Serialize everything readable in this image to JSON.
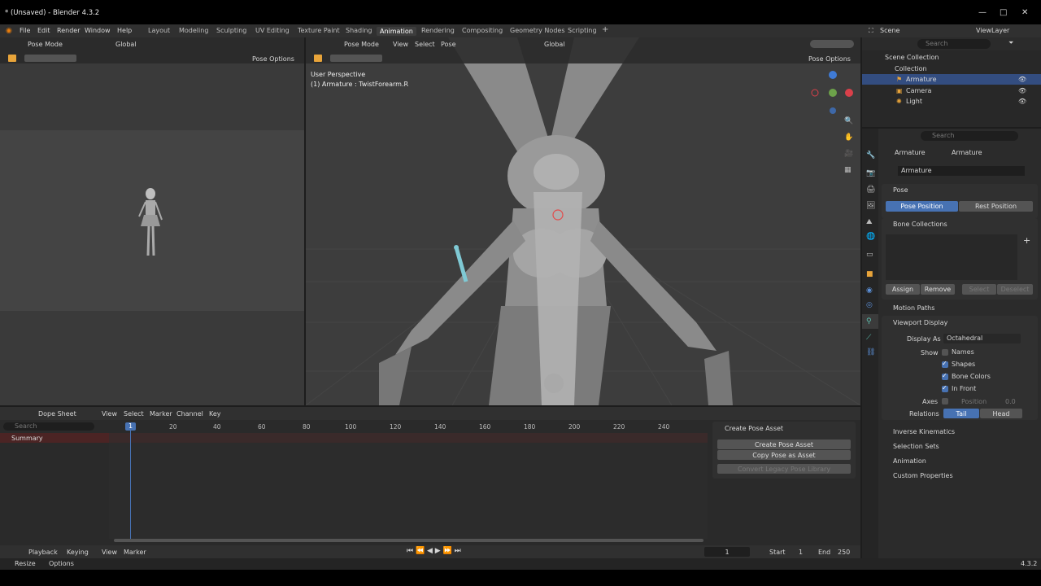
{
  "titlebar": {
    "title": "* (Unsaved) - Blender 4.3.2"
  },
  "menu": [
    "File",
    "Edit",
    "Render",
    "Window",
    "Help"
  ],
  "workspaces": [
    "Layout",
    "Modeling",
    "Sculpting",
    "UV Editing",
    "Texture Paint",
    "Shading",
    "Animation",
    "Rendering",
    "Compositing",
    "Geometry Nodes",
    "Scripting"
  ],
  "active_workspace": "Animation",
  "scene": {
    "label": "Scene",
    "viewlayer": "ViewLayer"
  },
  "left_view": {
    "mode": "Pose Mode",
    "orient": "Global",
    "pose_options": "Pose Options"
  },
  "main_view": {
    "mode": "Pose Mode",
    "menus": [
      "View",
      "Select",
      "Pose"
    ],
    "orient": "Global",
    "pose_options": "Pose Options",
    "overlay_line1": "User Perspective",
    "overlay_line2": "(1) Armature : TwistForearm.R"
  },
  "outliner": {
    "search_placeholder": "Search",
    "items": [
      "Scene Collection",
      "Collection",
      "Armature",
      "Camera",
      "Light"
    ]
  },
  "properties": {
    "search_placeholder": "Search",
    "breadcrumb": [
      "Armature",
      "Armature"
    ],
    "data_name": "Armature",
    "pose_header": "Pose",
    "pose_position": "Pose Position",
    "rest_position": "Rest Position",
    "bone_collections": "Bone Collections",
    "assign": "Assign",
    "remove": "Remove",
    "select": "Select",
    "deselect": "Deselect",
    "motion_paths": "Motion Paths",
    "viewport_display": "Viewport Display",
    "display_as_label": "Display As",
    "display_as_value": "Octahedral",
    "show_label": "Show",
    "names": "Names",
    "shapes": "Shapes",
    "bone_colors": "Bone Colors",
    "in_front": "In Front",
    "axes": "Axes",
    "position": "Position",
    "position_value": "0.0",
    "relations": "Relations",
    "tail": "Tail",
    "head": "Head",
    "inverse_kinematics": "Inverse Kinematics",
    "selection_sets": "Selection Sets",
    "animation": "Animation",
    "custom_properties": "Custom Properties"
  },
  "dopesheet": {
    "mode": "Dope Sheet",
    "menus": [
      "View",
      "Select",
      "Marker",
      "Channel",
      "Key"
    ],
    "search_placeholder": "Search",
    "summary": "Summary",
    "current_frame": "1",
    "ticks": [
      "20",
      "40",
      "60",
      "80",
      "100",
      "120",
      "140",
      "160",
      "180",
      "200",
      "220",
      "240"
    ],
    "asset_panel_title": "Create Pose Asset",
    "create_pose_asset": "Create Pose Asset",
    "copy_pose_as_asset": "Copy Pose as Asset",
    "convert_legacy": "Convert Legacy Pose Library"
  },
  "timeline": {
    "playback": "Playback",
    "keying": "Keying",
    "view": "View",
    "marker": "Marker",
    "frame": "1",
    "start_label": "Start",
    "start_value": "1",
    "end_label": "End",
    "end_value": "250"
  },
  "statusbar": {
    "resize": "Resize",
    "options": "Options",
    "version": "4.3.2"
  },
  "colors": {
    "accent": "#4772b3",
    "active_bone": "#7fc9d4",
    "header": "#303030",
    "panel": "#2e2e2e"
  }
}
